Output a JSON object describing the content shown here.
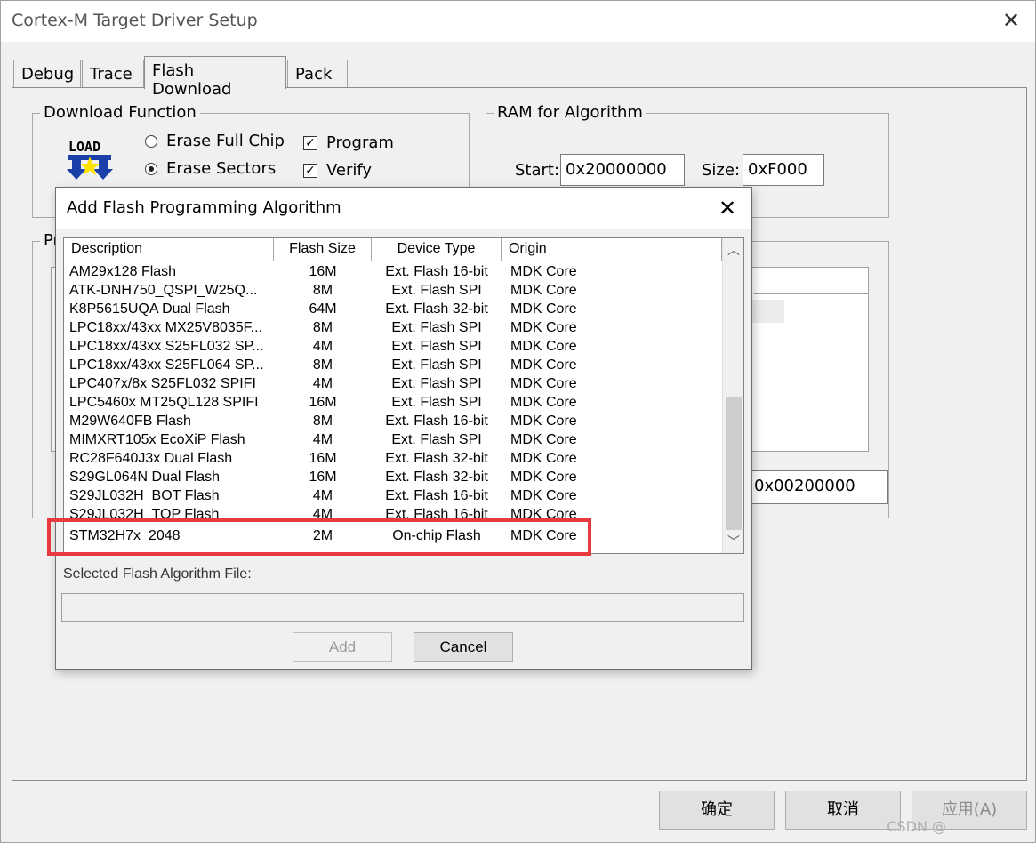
{
  "window": {
    "title": "Cortex-M Target Driver Setup",
    "close_glyph": "✕"
  },
  "tabs": [
    {
      "label": "Debug"
    },
    {
      "label": "Trace"
    },
    {
      "label": "Flash Download"
    },
    {
      "label": "Pack"
    }
  ],
  "download_function": {
    "title": "Download Function",
    "icon_label": "LOAD",
    "erase_full_chip": "Erase Full Chip",
    "erase_sectors": "Erase Sectors",
    "program": "Program",
    "verify": "Verify"
  },
  "ram_for_algorithm": {
    "title": "RAM for Algorithm",
    "start_label": "Start:",
    "start_value": "0x20000000",
    "size_label": "Size:",
    "size_value": "0xF000"
  },
  "programming_group_partial_title": "Pr",
  "partial_value": "0x00200000",
  "bottom_buttons": {
    "ok": "确定",
    "cancel": "取消",
    "apply": "应用(A)"
  },
  "watermark": "CSDN @",
  "dialog": {
    "title": "Add Flash Programming Algorithm",
    "close_glyph": "✕",
    "columns": [
      "Description",
      "Flash Size",
      "Device Type",
      "Origin"
    ],
    "rows": [
      [
        "AM29x128 Flash",
        "16M",
        "Ext. Flash 16-bit",
        "MDK Core"
      ],
      [
        "ATK-DNH750_QSPI_W25Q...",
        "8M",
        "Ext. Flash SPI",
        "MDK Core"
      ],
      [
        "K8P5615UQA Dual Flash",
        "64M",
        "Ext. Flash 32-bit",
        "MDK Core"
      ],
      [
        "LPC18xx/43xx MX25V8035F...",
        "8M",
        "Ext. Flash SPI",
        "MDK Core"
      ],
      [
        "LPC18xx/43xx S25FL032 SP...",
        "4M",
        "Ext. Flash SPI",
        "MDK Core"
      ],
      [
        "LPC18xx/43xx S25FL064 SP...",
        "8M",
        "Ext. Flash SPI",
        "MDK Core"
      ],
      [
        "LPC407x/8x S25FL032 SPIFI",
        "4M",
        "Ext. Flash SPI",
        "MDK Core"
      ],
      [
        "LPC5460x MT25QL128 SPIFI",
        "16M",
        "Ext. Flash SPI",
        "MDK Core"
      ],
      [
        "M29W640FB Flash",
        "8M",
        "Ext. Flash 16-bit",
        "MDK Core"
      ],
      [
        "MIMXRT105x EcoXiP Flash",
        "4M",
        "Ext. Flash SPI",
        "MDK Core"
      ],
      [
        "RC28F640J3x Dual Flash",
        "16M",
        "Ext. Flash 32-bit",
        "MDK Core"
      ],
      [
        "S29GL064N Dual Flash",
        "16M",
        "Ext. Flash 32-bit",
        "MDK Core"
      ],
      [
        "S29JL032H_BOT Flash",
        "4M",
        "Ext. Flash 16-bit",
        "MDK Core"
      ],
      [
        "S29JL032H_TOP Flash",
        "4M",
        "Ext. Flash 16-bit",
        "MDK Core"
      ],
      [
        "STM32H7x_2048",
        "2M",
        "On-chip Flash",
        "MDK Core"
      ]
    ],
    "selected_file_label": "Selected Flash Algorithm File:",
    "selected_file_value": "",
    "add_button": "Add",
    "cancel_button": "Cancel"
  },
  "colors": {
    "highlight": "#e8393f",
    "background": "#f0f0f0"
  }
}
